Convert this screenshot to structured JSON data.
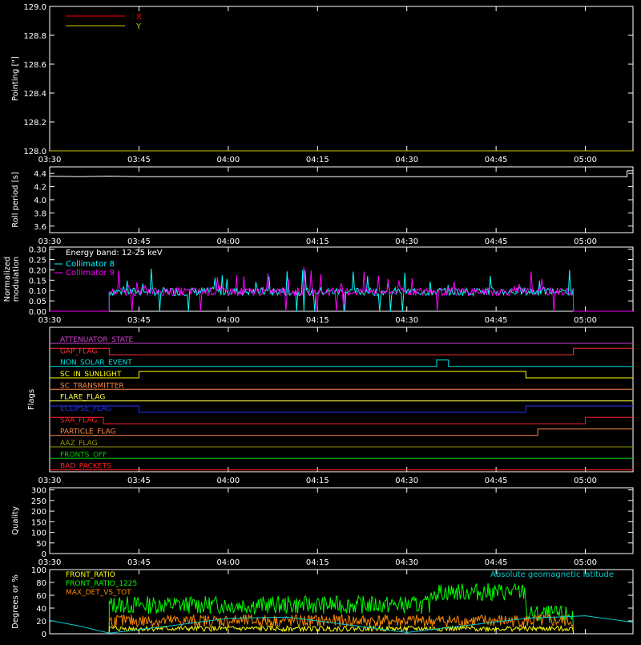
{
  "colors": {
    "bg": "#000000",
    "axis": "#ffffff",
    "x": "#ff0000",
    "y": "#cccc00",
    "roll": "#ffffff",
    "coll8": "#00ffff",
    "coll9": "#ff00ff",
    "front_ratio": "#ffff00",
    "front_ratio_1225": "#00ff00",
    "max_det": "#ff8800",
    "geolat": "#00cccc"
  },
  "chart_data": [
    {
      "type": "line",
      "id": "pointing",
      "ylabel": "Pointing [\"]",
      "ylim": [
        128.0,
        129.0
      ],
      "yticks": [
        "128.0",
        "128.2",
        "128.4",
        "128.6",
        "128.8",
        "129.0"
      ],
      "xtick_labels": [
        "03:30",
        "03:45",
        "04:00",
        "04:15",
        "04:30",
        "04:45",
        "05:00"
      ],
      "legend_position": "top-left",
      "series": [
        {
          "name": "X",
          "color_key": "x",
          "x": [
            "03:30",
            "05:08"
          ],
          "y": [
            128.0,
            128.0
          ]
        },
        {
          "name": "Y",
          "color_key": "y",
          "x": [
            "03:30",
            "05:08"
          ],
          "y": [
            128.0,
            128.0
          ]
        }
      ]
    },
    {
      "type": "line",
      "id": "roll",
      "ylabel": "Roll period [s]",
      "ylim": [
        3.5,
        4.5
      ],
      "yticks": [
        "3.6",
        "3.8",
        "4.0",
        "4.2",
        "4.4"
      ],
      "xtick_labels": [
        "03:30",
        "03:45",
        "04:00",
        "04:15",
        "04:30",
        "04:45",
        "05:00"
      ],
      "series": [
        {
          "name": "",
          "color_key": "roll",
          "x": [
            "03:30",
            "03:35",
            "03:40",
            "03:45",
            "04:00",
            "04:30",
            "05:07",
            "05:07",
            "05:08"
          ],
          "y": [
            4.36,
            4.35,
            4.36,
            4.35,
            4.35,
            4.35,
            4.35,
            4.44,
            4.44
          ]
        }
      ]
    },
    {
      "type": "line",
      "id": "modulation",
      "ylabel": "Normalized modulation",
      "ylim": [
        0.0,
        0.31
      ],
      "yticks": [
        "0.00",
        "0.05",
        "0.10",
        "0.15",
        "0.20",
        "0.25",
        "0.30"
      ],
      "xtick_labels": [
        "03:30",
        "03:45",
        "04:00",
        "04:15",
        "04:30",
        "04:45",
        "05:00"
      ],
      "annotation": "Energy band: 12-25 keV",
      "legend_position": "top-left",
      "data_range": [
        "03:40",
        "04:58"
      ],
      "baseline": 0.095,
      "series": [
        {
          "name": "Collimator 8",
          "color_key": "coll8"
        },
        {
          "name": "Collimator 9",
          "color_key": "coll9"
        }
      ]
    },
    {
      "type": "line",
      "id": "flags",
      "ylabel": "Flags",
      "xtick_labels": [
        "03:30",
        "03:45",
        "04:00",
        "04:15",
        "04:30",
        "04:45",
        "05:00"
      ],
      "series": [
        {
          "name": "ATTENUATOR_STATE",
          "color": "#cc44cc",
          "x": [
            "03:30",
            "05:08"
          ],
          "y": [
            0,
            0
          ]
        },
        {
          "name": "GAP_FLAG",
          "color": "#ff3333",
          "x": [
            "03:30",
            "03:40",
            "03:40",
            "04:58",
            "04:58",
            "05:08"
          ],
          "y": [
            1,
            1,
            0,
            0,
            1,
            1
          ]
        },
        {
          "name": "NON_SOLAR_EVENT",
          "color": "#00dddd",
          "x": [
            "03:30",
            "04:35",
            "04:35",
            "04:37",
            "04:37",
            "05:08"
          ],
          "y": [
            0,
            0,
            1,
            1,
            0,
            0
          ]
        },
        {
          "name": "SC_IN_SUNLIGHT",
          "color": "#ffff00",
          "x": [
            "03:30",
            "03:45",
            "03:45",
            "04:50",
            "04:50",
            "05:08"
          ],
          "y": [
            0,
            0,
            1,
            1,
            0,
            0
          ]
        },
        {
          "name": "SC_TRANSMITTER",
          "color": "#ff8844",
          "x": [
            "03:30",
            "05:08"
          ],
          "y": [
            0,
            0
          ]
        },
        {
          "name": "FLARE_FLAG",
          "color": "#ffff44",
          "x": [
            "03:30",
            "05:08"
          ],
          "y": [
            0,
            0
          ]
        },
        {
          "name": "ECLIPSE_FLAG",
          "color": "#2233ff",
          "x": [
            "03:30",
            "03:45",
            "03:45",
            "04:50",
            "04:50",
            "05:08"
          ],
          "y": [
            1,
            1,
            0,
            0,
            1,
            1
          ]
        },
        {
          "name": "SAA_FLAG",
          "color": "#ff2222",
          "x": [
            "03:30",
            "03:39",
            "03:39",
            "05:00",
            "05:00",
            "05:08"
          ],
          "y": [
            1,
            1,
            0,
            0,
            1,
            1
          ]
        },
        {
          "name": "PARTICLE_FLAG",
          "color": "#ff8844",
          "x": [
            "03:30",
            "04:52",
            "04:52",
            "05:08"
          ],
          "y": [
            0,
            0,
            1,
            1
          ]
        },
        {
          "name": "AAZ_FLAG",
          "color": "#999900",
          "x": [
            "03:30",
            "05:08"
          ],
          "y": [
            0,
            0
          ]
        },
        {
          "name": "FRONTS_OFF",
          "color": "#00cc00",
          "x": [
            "03:30",
            "05:08"
          ],
          "y": [
            0,
            0
          ]
        },
        {
          "name": "BAD_PACKETS",
          "color": "#ff2222",
          "x": [
            "03:30",
            "05:08"
          ],
          "y": [
            0,
            0
          ]
        }
      ]
    },
    {
      "type": "line",
      "id": "quality",
      "ylabel": "Quality",
      "ylim": [
        0,
        310
      ],
      "yticks": [
        "0",
        "50",
        "100",
        "150",
        "200",
        "250",
        "300"
      ],
      "xtick_labels": [
        "03:30",
        "03:45",
        "04:00",
        "04:15",
        "04:30",
        "04:45",
        "05:00"
      ],
      "series": []
    },
    {
      "type": "line",
      "id": "ratios",
      "ylabel": "Degrees or %",
      "ylim": [
        0,
        100
      ],
      "yticks": [
        "0",
        "20",
        "40",
        "60",
        "80",
        "100"
      ],
      "legend_position": "top-left",
      "annotation": "Absolute geomagnetic latitude",
      "data_range": [
        "03:40",
        "04:58"
      ],
      "series": [
        {
          "name": "FRONT_RATIO",
          "color_key": "front_ratio",
          "level": 8
        },
        {
          "name": "FRONT_RATIO_1225",
          "color_key": "front_ratio_1225",
          "level": 45,
          "segments": [
            {
              "from": "03:40",
              "to": "04:34",
              "level": 45
            },
            {
              "from": "04:34",
              "to": "04:50",
              "level": 65
            },
            {
              "from": "04:50",
              "to": "04:58",
              "level": 30
            }
          ]
        },
        {
          "name": "MAX_DET_VS_TOT",
          "color_key": "max_det",
          "level": 20
        },
        {
          "name": "Absolute geomagnetic latitude",
          "color_key": "geolat",
          "x": [
            "03:30",
            "03:35",
            "03:40",
            "03:50",
            "04:00",
            "04:10",
            "04:20",
            "04:30",
            "04:40",
            "04:50",
            "05:00",
            "05:08"
          ],
          "y": [
            21,
            12,
            1,
            12,
            24,
            26,
            14,
            2,
            13,
            24,
            28,
            18
          ]
        }
      ]
    }
  ]
}
